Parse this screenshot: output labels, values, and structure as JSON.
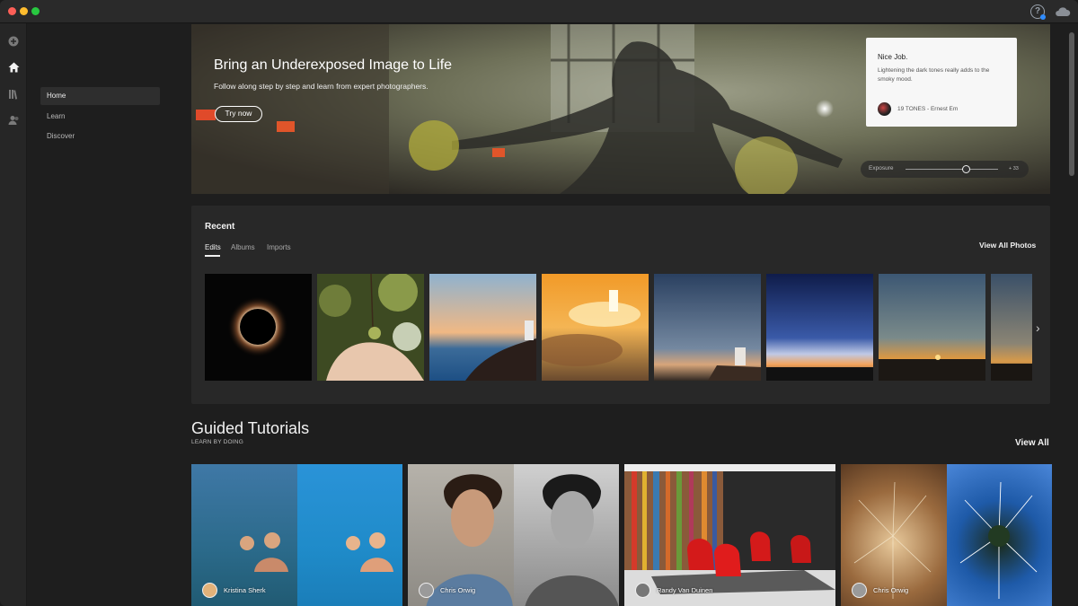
{
  "window": {
    "title": ""
  },
  "rail": {
    "items": [
      {
        "icon": "plus-circle-icon"
      },
      {
        "icon": "home-icon"
      },
      {
        "icon": "library-icon"
      },
      {
        "icon": "people-icon"
      }
    ]
  },
  "nav": {
    "items": [
      {
        "label": "Home",
        "active": true
      },
      {
        "label": "Learn",
        "active": false
      },
      {
        "label": "Discover",
        "active": false
      }
    ]
  },
  "hero": {
    "title": "Bring an Underexposed Image to Life",
    "subtitle": "Follow along step by step and learn from expert photographers.",
    "button_label": "Try now",
    "card": {
      "title": "Nice Job.",
      "body": "Lightening the dark tones really adds to the smoky mood.",
      "author": "19 TONES - Ernest Em"
    },
    "exposure": {
      "label": "Exposure",
      "value": "+ 33"
    }
  },
  "recent": {
    "title": "Recent",
    "tabs": [
      {
        "label": "Edits",
        "active": true
      },
      {
        "label": "Albums",
        "active": false
      },
      {
        "label": "Imports",
        "active": false
      }
    ],
    "view_all_label": "View All Photos",
    "thumbnails": [
      "solar-eclipse",
      "hand-holding-fruit",
      "telescope-dusk-sea",
      "sunset-clouds",
      "observatory-blue-sky",
      "horizon-glow",
      "sunrise-horizon",
      "partial-sunset"
    ]
  },
  "guided": {
    "title": "Guided Tutorials",
    "subtitle": "LEARN BY DOING",
    "view_all_label": "View All",
    "tutorials": [
      {
        "author": "Kristina Sherk",
        "image": "mother-child-pool"
      },
      {
        "author": "Chris Orwig",
        "image": "portrait-color-bw"
      },
      {
        "author": "Randy Van Duinen",
        "image": "red-chairs-interior"
      },
      {
        "author": "Chris Orwig",
        "image": "dandelion-closeup"
      }
    ]
  },
  "colors": {
    "accent": "#2f8cff",
    "panel": "#282828",
    "background": "#1e1e1e"
  }
}
